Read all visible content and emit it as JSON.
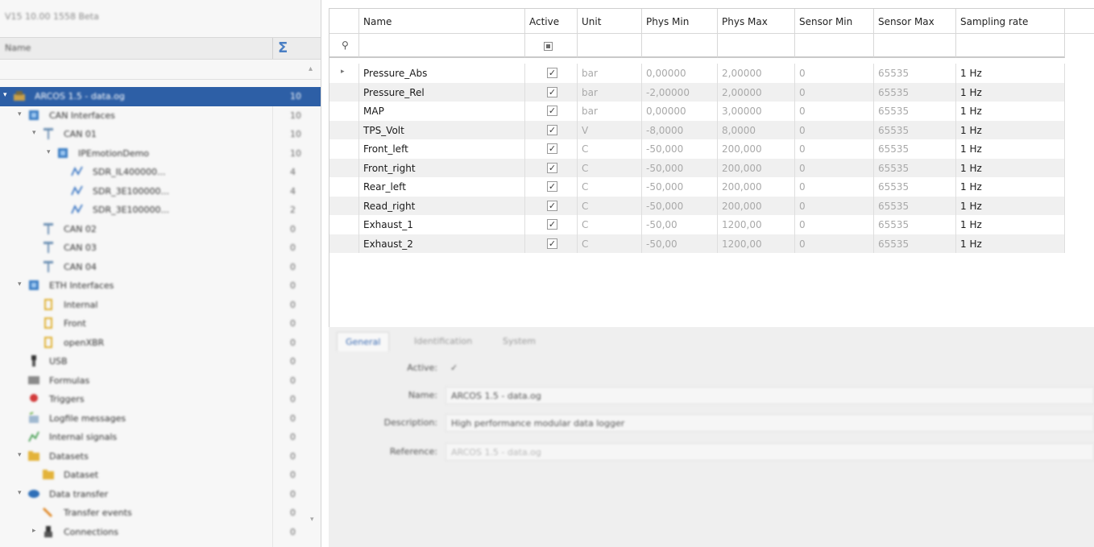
{
  "tree": {
    "title": "V15 10.00 1558 Beta",
    "column_name": "Name",
    "nodes": [
      {
        "label": "ARCOS 1.5 - data.og",
        "count": "10",
        "indent": 0,
        "icon": "device-icon",
        "exp": "▾",
        "selected": true
      },
      {
        "label": "CAN Interfaces",
        "count": "10",
        "indent": 1,
        "icon": "interface-icon",
        "exp": "▾"
      },
      {
        "label": "CAN 01",
        "count": "10",
        "indent": 2,
        "icon": "can-bus-icon",
        "exp": "▾"
      },
      {
        "label": "IPEmotionDemo",
        "count": "10",
        "indent": 3,
        "icon": "interface-icon",
        "exp": "▾"
      },
      {
        "label": "SDR_IL400000...",
        "count": "4",
        "indent": 4,
        "icon": "signal-icon",
        "exp": ""
      },
      {
        "label": "SDR_3E100000...",
        "count": "4",
        "indent": 4,
        "icon": "signal-icon",
        "exp": ""
      },
      {
        "label": "SDR_3E100000...",
        "count": "2",
        "indent": 4,
        "icon": "signal-icon",
        "exp": ""
      },
      {
        "label": "CAN 02",
        "count": "0",
        "indent": 2,
        "icon": "can-bus-icon",
        "exp": ""
      },
      {
        "label": "CAN 03",
        "count": "0",
        "indent": 2,
        "icon": "can-bus-icon",
        "exp": ""
      },
      {
        "label": "CAN 04",
        "count": "0",
        "indent": 2,
        "icon": "can-bus-icon",
        "exp": ""
      },
      {
        "label": "ETH Interfaces",
        "count": "0",
        "indent": 1,
        "icon": "interface-icon",
        "exp": "▾"
      },
      {
        "label": "Internal",
        "count": "0",
        "indent": 2,
        "icon": "ethernet-icon",
        "exp": ""
      },
      {
        "label": "Front",
        "count": "0",
        "indent": 2,
        "icon": "ethernet-icon",
        "exp": ""
      },
      {
        "label": "openXBR",
        "count": "0",
        "indent": 2,
        "icon": "ethernet-icon",
        "exp": ""
      },
      {
        "label": "USB",
        "count": "0",
        "indent": 1,
        "icon": "usb-icon",
        "exp": ""
      },
      {
        "label": "Formulas",
        "count": "0",
        "indent": 1,
        "icon": "formula-icon",
        "exp": ""
      },
      {
        "label": "Triggers",
        "count": "0",
        "indent": 1,
        "icon": "trigger-icon",
        "exp": ""
      },
      {
        "label": "Logfile messages",
        "count": "0",
        "indent": 1,
        "icon": "log-icon",
        "exp": ""
      },
      {
        "label": "Internal signals",
        "count": "0",
        "indent": 1,
        "icon": "internal-signal-icon",
        "exp": ""
      },
      {
        "label": "Datasets",
        "count": "0",
        "indent": 1,
        "icon": "folder-icon",
        "exp": "▾"
      },
      {
        "label": "Dataset",
        "count": "0",
        "indent": 2,
        "icon": "folder-icon",
        "exp": ""
      },
      {
        "label": "Data transfer",
        "count": "0",
        "indent": 1,
        "icon": "transfer-icon",
        "exp": "▾"
      },
      {
        "label": "Transfer events",
        "count": "0",
        "indent": 2,
        "icon": "event-icon",
        "exp": ""
      },
      {
        "label": "Connections",
        "count": "0",
        "indent": 2,
        "icon": "connection-icon",
        "exp": "▸"
      }
    ]
  },
  "grid": {
    "columns": [
      "Name",
      "Active",
      "Unit",
      "Phys Min",
      "Phys Max",
      "Sensor Min",
      "Sensor Max",
      "Sampling rate"
    ],
    "rows": [
      {
        "name": "Pressure_Abs",
        "unit": "bar",
        "phys_min": "0,00000",
        "phys_max": "2,00000",
        "sensor_min": "0",
        "sensor_max": "65535",
        "rate": "1 Hz",
        "active": "✓"
      },
      {
        "name": "Pressure_Rel",
        "unit": "bar",
        "phys_min": "-2,00000",
        "phys_max": "2,00000",
        "sensor_min": "0",
        "sensor_max": "65535",
        "rate": "1 Hz",
        "active": "✓"
      },
      {
        "name": "MAP",
        "unit": "bar",
        "phys_min": "0,00000",
        "phys_max": "3,00000",
        "sensor_min": "0",
        "sensor_max": "65535",
        "rate": "1 Hz",
        "active": "✓"
      },
      {
        "name": "TPS_Volt",
        "unit": "V",
        "phys_min": "-8,0000",
        "phys_max": "8,0000",
        "sensor_min": "0",
        "sensor_max": "65535",
        "rate": "1 Hz",
        "active": "✓"
      },
      {
        "name": "Front_left",
        "unit": "C",
        "phys_min": "-50,000",
        "phys_max": "200,000",
        "sensor_min": "0",
        "sensor_max": "65535",
        "rate": "1 Hz",
        "active": "✓"
      },
      {
        "name": "Front_right",
        "unit": "C",
        "phys_min": "-50,000",
        "phys_max": "200,000",
        "sensor_min": "0",
        "sensor_max": "65535",
        "rate": "1 Hz",
        "active": "✓"
      },
      {
        "name": "Rear_left",
        "unit": "C",
        "phys_min": "-50,000",
        "phys_max": "200,000",
        "sensor_min": "0",
        "sensor_max": "65535",
        "rate": "1 Hz",
        "active": "✓"
      },
      {
        "name": "Read_right",
        "unit": "C",
        "phys_min": "-50,000",
        "phys_max": "200,000",
        "sensor_min": "0",
        "sensor_max": "65535",
        "rate": "1 Hz",
        "active": "✓"
      },
      {
        "name": "Exhaust_1",
        "unit": "C",
        "phys_min": "-50,00",
        "phys_max": "1200,00",
        "sensor_min": "0",
        "sensor_max": "65535",
        "rate": "1 Hz",
        "active": "✓"
      },
      {
        "name": "Exhaust_2",
        "unit": "C",
        "phys_min": "-50,00",
        "phys_max": "1200,00",
        "sensor_min": "0",
        "sensor_max": "65535",
        "rate": "1 Hz",
        "active": "✓"
      }
    ],
    "row_indicator": "▸",
    "pin_glyph": "⚲"
  },
  "detail": {
    "tabs": [
      "General",
      "Identification",
      "System"
    ],
    "fields": [
      {
        "label": "Active:",
        "value": "✓"
      },
      {
        "label": "Name:",
        "value": "ARCOS 1.5 - data.og"
      },
      {
        "label": "Description:",
        "value": "High performance modular data logger"
      },
      {
        "label": "Reference:",
        "value": "ARCOS 1.5 - data.og"
      }
    ]
  },
  "colors": {
    "selection": "#2d5fa6",
    "accent": "#3c6cb2"
  }
}
